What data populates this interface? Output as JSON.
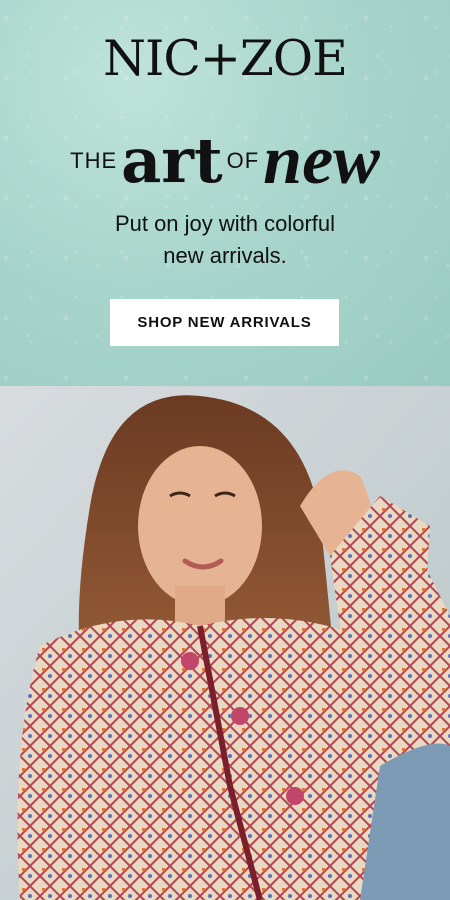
{
  "brand": {
    "logo_text": "NIC+ZOE"
  },
  "headline": {
    "the": "THE",
    "art": "art",
    "of": "OF",
    "new": "new"
  },
  "subheadline": {
    "line1": "Put on joy with colorful",
    "line2": "new arrivals."
  },
  "cta": {
    "label": "SHOP NEW ARRIVALS"
  },
  "colors": {
    "top_background": "#a9d6cc",
    "button_background": "#ffffff",
    "text": "#111111"
  },
  "photo": {
    "icon": "model-photo"
  }
}
